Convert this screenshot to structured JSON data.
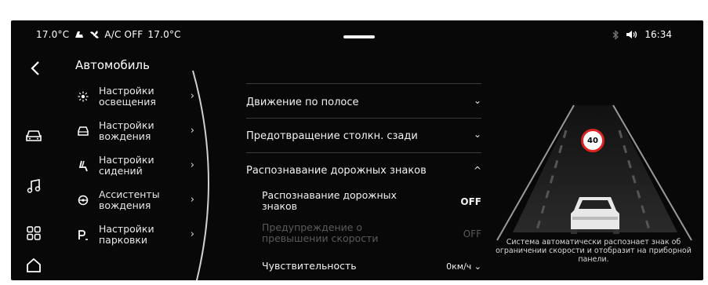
{
  "status": {
    "temp_left": "17.0°C",
    "ac_text": "A/C OFF",
    "temp_right": "17.0°C",
    "time": "16:34"
  },
  "nav": {
    "back_icon": "chevron-left-icon",
    "rail_icons": [
      "car-icon",
      "music-icon",
      "apps-grid-icon",
      "home-icon"
    ]
  },
  "category": {
    "title": "Автомобиль",
    "items": [
      {
        "label": "Настройки освещения",
        "icon": "sun-icon"
      },
      {
        "label": "Настройки вождения",
        "icon": "car-front-icon"
      },
      {
        "label": "Настройки сидений",
        "icon": "seat-icon"
      },
      {
        "label": "Ассистенты вождения",
        "icon": "steering-wheel-icon"
      },
      {
        "label": "Настройки парковки",
        "icon": "parking-icon"
      }
    ]
  },
  "settings": {
    "rows": [
      {
        "label": "Движение по полосе",
        "expanded": false
      },
      {
        "label": "Предотвращение столкн. сзади",
        "expanded": false
      },
      {
        "label": "Распознавание дорожных знаков",
        "expanded": true
      }
    ],
    "sub": [
      {
        "label": "Распознавание дорожных знаков",
        "value": "OFF",
        "disabled": false
      },
      {
        "label": "Предупреждение о превышении скорости",
        "value": "OFF",
        "disabled": true
      },
      {
        "label": "Чувствительность",
        "value": "0км/ч",
        "disabled": false
      }
    ]
  },
  "illustration": {
    "sign_value": "40",
    "caption": "Система автоматически распознает знак об ограничении скорости и отобразит на приборной панели."
  },
  "colors": {
    "background": "#080808",
    "accent_sign": "#dd2222"
  }
}
